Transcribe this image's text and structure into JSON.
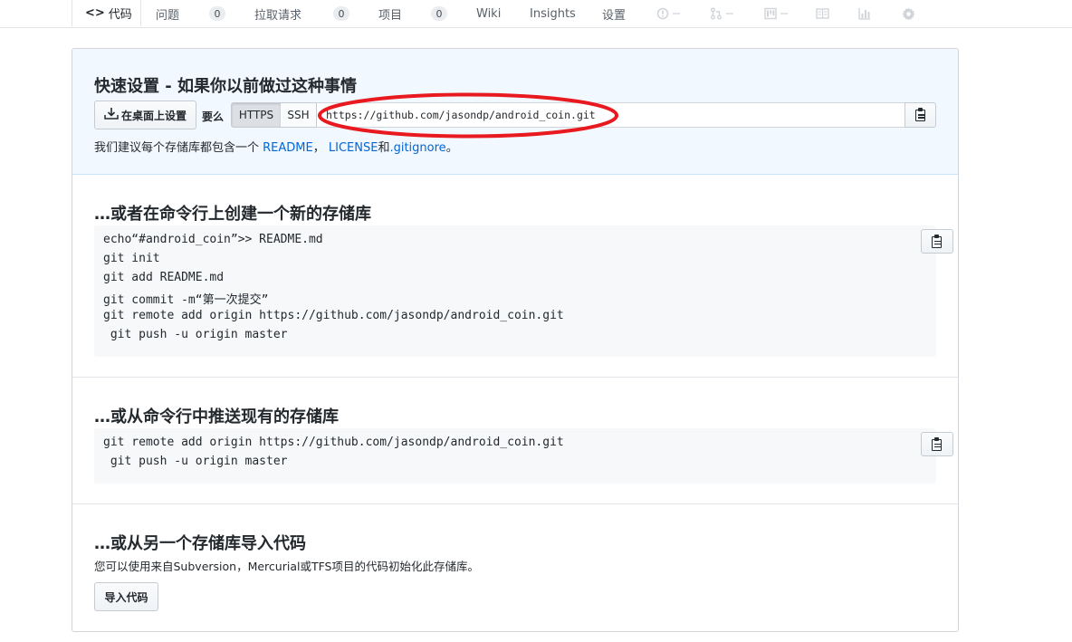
{
  "tabs": [
    {
      "label": "代码",
      "glyph": "<>"
    },
    {
      "label": "问题",
      "count": "0"
    },
    {
      "label": "拉取请求",
      "count": "0"
    },
    {
      "label": "项目",
      "count": "0"
    },
    {
      "label": "Wiki"
    },
    {
      "label": "Insights"
    },
    {
      "label": "设置"
    }
  ],
  "quick_setup": {
    "title": "快速设置 - 如果你以前做过这种事情",
    "desktop_button": "在桌面上设置",
    "or_label": "要么",
    "protocols": [
      "HTTPS",
      "SSH"
    ],
    "selected_protocol": "HTTPS",
    "clone_url": "https://github.com/jasondp/android_coin.git",
    "note_prefix": "我们建议每个存储库都包含一个 ",
    "note_readme": "README",
    "note_sep": "，",
    "note_license": "LICENSE",
    "note_and": "和",
    "note_gitignore": ".gitignore",
    "note_end": "。"
  },
  "create_section": {
    "title": "…或者在命令行上创建一个新的存储库",
    "code": [
      "echo“#android_coin”>> README.md",
      "git init",
      "git add README.md",
      "git commit -m“第一次提交”",
      "git remote add origin https://github.com/jasondp/android_coin.git",
      " git push -u origin master"
    ]
  },
  "push_section": {
    "title": "…或从命令行中推送现有的存储库",
    "code": [
      "git remote add origin https://github.com/jasondp/android_coin.git",
      " git push -u origin master"
    ]
  },
  "import_section": {
    "title": "…或从另一个存储库导入代码",
    "description": "您可以使用来自Subversion，Mercurial或TFS项目的代码初始化此存储库。",
    "button": "导入代码"
  },
  "colors": {
    "accent_tab": "#e36209",
    "link": "#0366d6",
    "quick_bg": "#f1f8ff",
    "annotation": "#e8191f"
  }
}
